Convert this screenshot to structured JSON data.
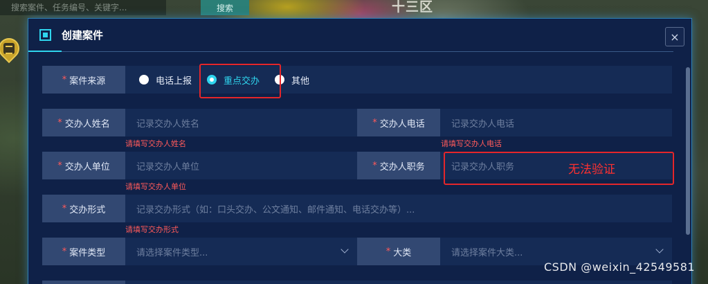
{
  "map": {
    "search_placeholder": "搜索案件、任务编号、关键字...",
    "search_button": "搜索",
    "district_label": "十三区"
  },
  "modal": {
    "title": "创建案件",
    "close_label": "×"
  },
  "form": {
    "source": {
      "label": "案件来源",
      "options": [
        "电话上报",
        "重点交办",
        "其他"
      ],
      "selected": "重点交办"
    },
    "assigner_name": {
      "label": "交办人姓名",
      "placeholder": "记录交办人姓名",
      "error": "请填写交办人姓名"
    },
    "assigner_phone": {
      "label": "交办人电话",
      "placeholder": "记录交办人电话",
      "error": "请填写交办人电话"
    },
    "assigner_unit": {
      "label": "交办人单位",
      "placeholder": "记录交办人单位",
      "error": "请填写交办人单位"
    },
    "assigner_position": {
      "label": "交办人职务",
      "placeholder": "记录交办人职务"
    },
    "assign_method": {
      "label": "交办形式",
      "placeholder": "记录交办形式（如：口头交办、公文通知、邮件通知、电话交办等）...",
      "error": "请填写交办形式"
    },
    "case_type": {
      "label": "案件类型",
      "placeholder": "请选择案件类型..."
    },
    "category": {
      "label": "大类",
      "placeholder": "请选择案件大类..."
    }
  },
  "annotation": {
    "text": "无法验证"
  },
  "watermark": "CSDN @weixin_42549581",
  "colors": {
    "accent": "#2fd5ee",
    "error": "#ff5a5a",
    "annotation": "#e5262a"
  }
}
